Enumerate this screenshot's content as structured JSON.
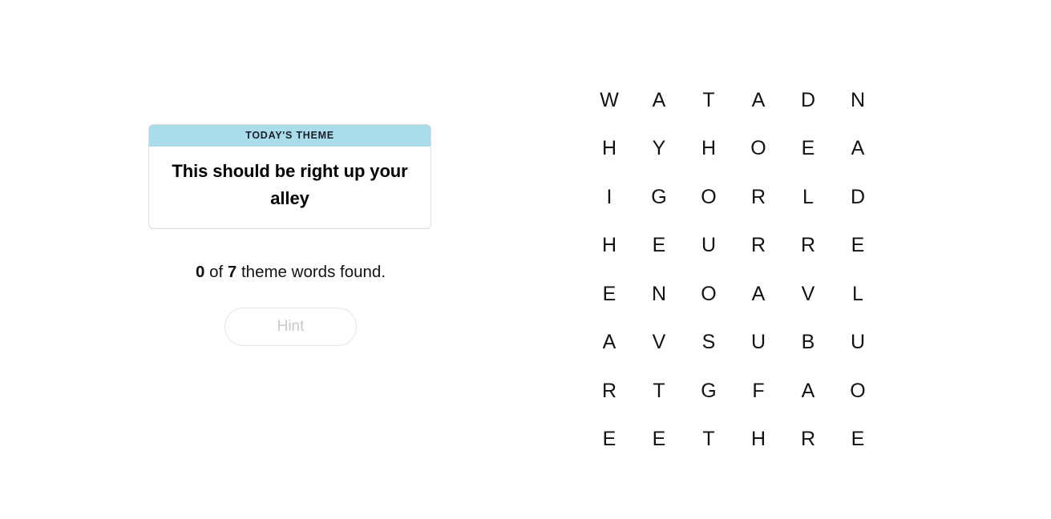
{
  "theme_card": {
    "header_label": "TODAY'S THEME",
    "theme_text": "This should be right up your alley",
    "header_color": "#abdcea",
    "border_color": "#dcdcdc"
  },
  "progress": {
    "found_count": "0",
    "connector": " of ",
    "total_count": "7",
    "suffix": " theme words found."
  },
  "hint_button": {
    "label": "Hint",
    "enabled": false,
    "text_color": "#c9c9cd",
    "border_color": "#e6e6e8"
  },
  "grid": {
    "rows": 8,
    "columns": 6,
    "letters": [
      [
        "W",
        "A",
        "T",
        "A",
        "D",
        "N"
      ],
      [
        "H",
        "Y",
        "H",
        "O",
        "E",
        "A"
      ],
      [
        "I",
        "G",
        "O",
        "R",
        "L",
        "D"
      ],
      [
        "H",
        "E",
        "U",
        "R",
        "R",
        "E"
      ],
      [
        "E",
        "N",
        "O",
        "A",
        "V",
        "L"
      ],
      [
        "A",
        "V",
        "S",
        "U",
        "B",
        "U"
      ],
      [
        "R",
        "T",
        "G",
        "F",
        "A",
        "O"
      ],
      [
        "E",
        "E",
        "T",
        "H",
        "R",
        "E"
      ]
    ]
  }
}
